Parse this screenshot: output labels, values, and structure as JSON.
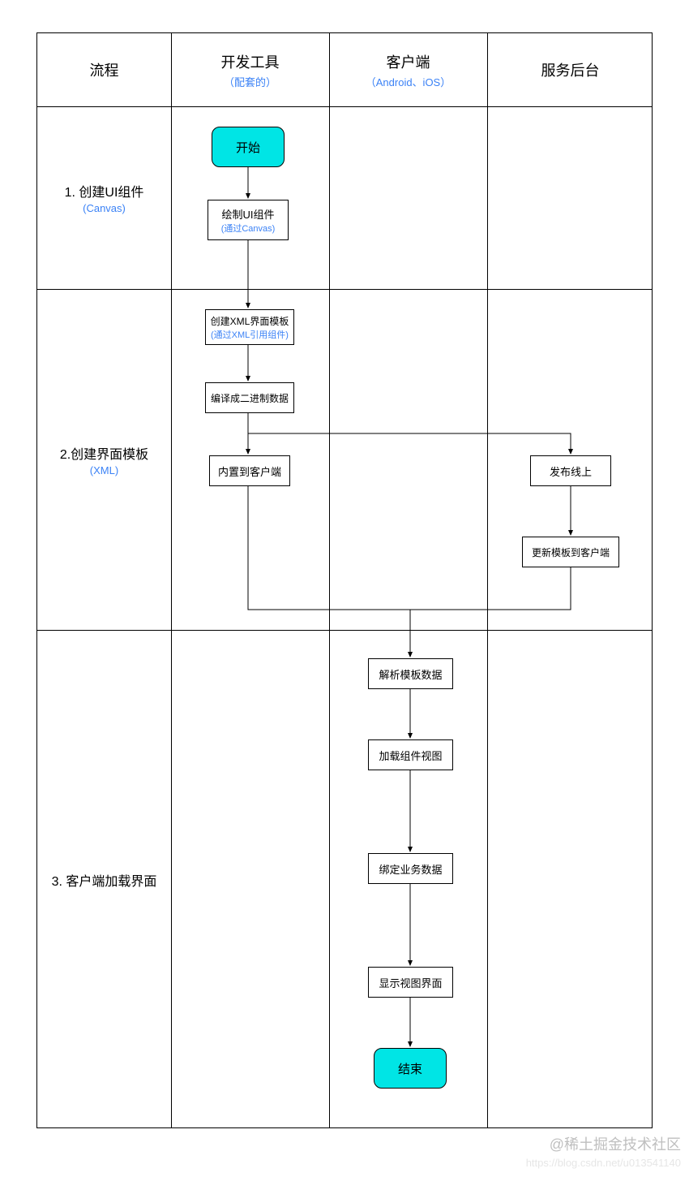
{
  "headers": {
    "col1": "流程",
    "col2": "开发工具",
    "col2_sub": "（配套的）",
    "col3": "客户端",
    "col3_sub": "（Android、iOS）",
    "col4": "服务后台"
  },
  "rows": {
    "r1_main": "1. 创建UI组件",
    "r1_sub": "(Canvas)",
    "r2_main": "2.创建界面模板",
    "r2_sub": "(XML)",
    "r3_main": "3. 客户端加载界面"
  },
  "nodes": {
    "start": "开始",
    "draw_ui": "绘制UI组件",
    "draw_ui_sub": "(通过Canvas)",
    "create_xml": "创建XML界面模板",
    "create_xml_sub": "(通过XML引用组件)",
    "compile": "编译成二进制数据",
    "builtin": "内置到客户端",
    "publish": "发布线上",
    "update": "更新模板到客户端",
    "parse": "解析模板数据",
    "load_view": "加载组件视图",
    "bind_data": "绑定业务数据",
    "show_view": "显示视图界面",
    "end": "结束"
  },
  "watermark": {
    "l1": "@稀土掘金技术社区",
    "l2": "https://blog.csdn.net/u013541140"
  },
  "chart_data": {
    "type": "flowchart-swimlane",
    "columns": [
      "流程",
      "开发工具（配套的）",
      "客户端（Android、iOS）",
      "服务后台"
    ],
    "lanes": [
      {
        "label": "1. 创建UI组件 (Canvas)"
      },
      {
        "label": "2.创建界面模板 (XML)"
      },
      {
        "label": "3. 客户端加载界面"
      }
    ],
    "nodes": [
      {
        "id": "start",
        "label": "开始",
        "column": "开发工具",
        "lane": 1,
        "shape": "rounded",
        "fill": "#00e5e5"
      },
      {
        "id": "draw",
        "label": "绘制UI组件 (通过Canvas)",
        "column": "开发工具",
        "lane": 1,
        "shape": "rect"
      },
      {
        "id": "xml",
        "label": "创建XML界面模板 (通过XML引用组件)",
        "column": "开发工具",
        "lane": 2,
        "shape": "rect"
      },
      {
        "id": "compile",
        "label": "编译成二进制数据",
        "column": "开发工具",
        "lane": 2,
        "shape": "rect"
      },
      {
        "id": "builtin",
        "label": "内置到客户端",
        "column": "开发工具",
        "lane": 2,
        "shape": "rect"
      },
      {
        "id": "publish",
        "label": "发布线上",
        "column": "服务后台",
        "lane": 2,
        "shape": "rect"
      },
      {
        "id": "update",
        "label": "更新模板到客户端",
        "column": "服务后台",
        "lane": 2,
        "shape": "rect"
      },
      {
        "id": "parse",
        "label": "解析模板数据",
        "column": "客户端",
        "lane": 3,
        "shape": "rect"
      },
      {
        "id": "loadview",
        "label": "加载组件视图",
        "column": "客户端",
        "lane": 3,
        "shape": "rect"
      },
      {
        "id": "binddata",
        "label": "绑定业务数据",
        "column": "客户端",
        "lane": 3,
        "shape": "rect"
      },
      {
        "id": "showview",
        "label": "显示视图界面",
        "column": "客户端",
        "lane": 3,
        "shape": "rect"
      },
      {
        "id": "end",
        "label": "结束",
        "column": "客户端",
        "lane": 3,
        "shape": "rounded",
        "fill": "#00e5e5"
      }
    ],
    "edges": [
      [
        "start",
        "draw"
      ],
      [
        "draw",
        "xml"
      ],
      [
        "xml",
        "compile"
      ],
      [
        "compile",
        "builtin"
      ],
      [
        "compile",
        "publish"
      ],
      [
        "publish",
        "update"
      ],
      [
        "builtin",
        "parse"
      ],
      [
        "update",
        "parse"
      ],
      [
        "parse",
        "loadview"
      ],
      [
        "loadview",
        "binddata"
      ],
      [
        "binddata",
        "showview"
      ],
      [
        "showview",
        "end"
      ]
    ]
  }
}
